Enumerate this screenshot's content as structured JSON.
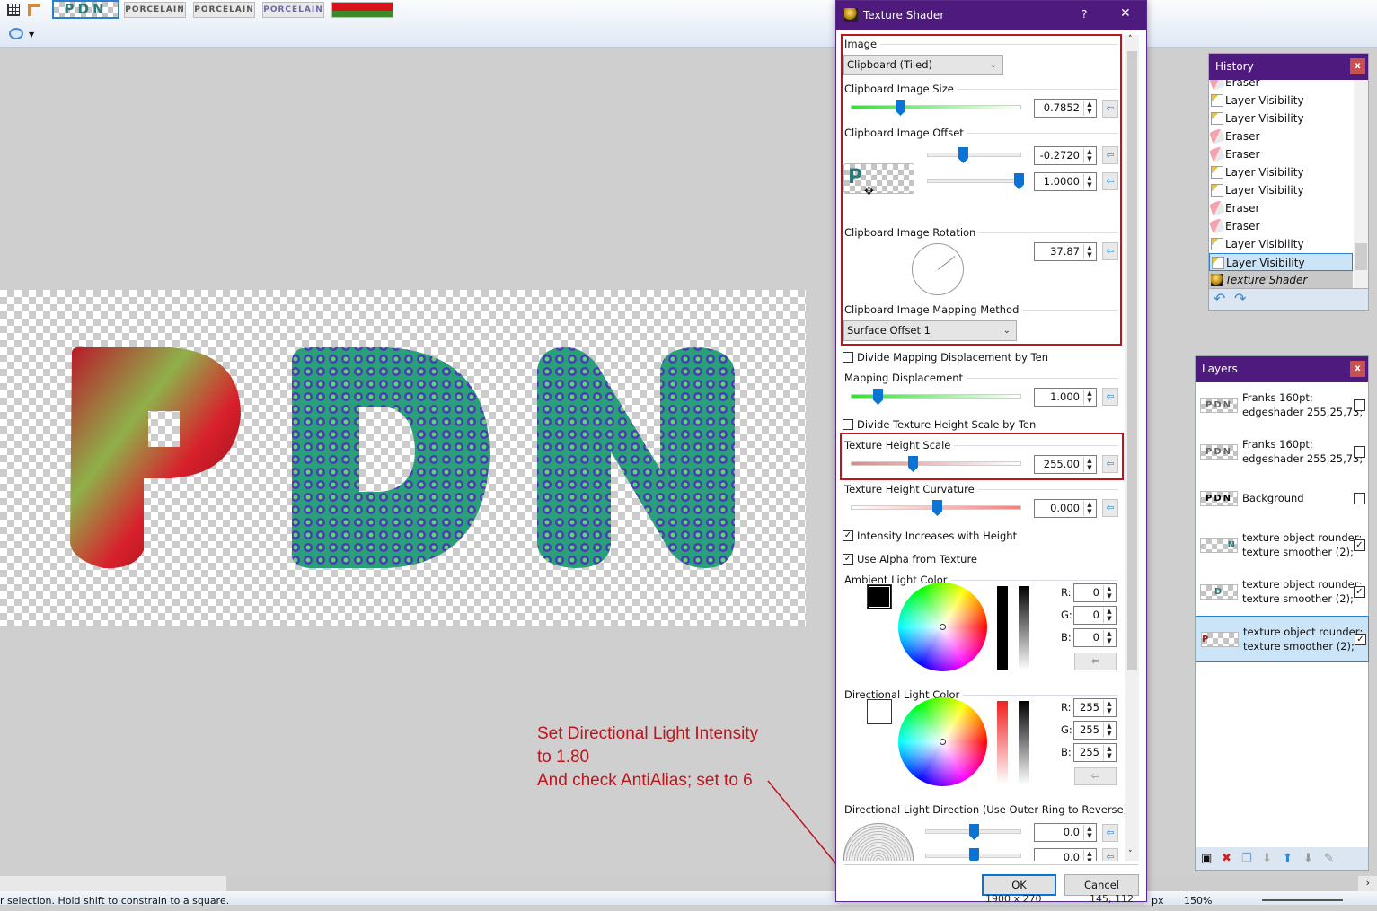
{
  "toolbar": {
    "image_tabs": [
      "PDN",
      "PORCELAIN",
      "PORCELAIN",
      "PORCELAIN"
    ],
    "grid_icon": "grid-icon",
    "ruler_icon": "ruler-icon",
    "selection_icon": "ellipse-select-icon"
  },
  "status": {
    "hint": "r selection. Hold shift to constrain to a square.",
    "size": "1900 x 270",
    "coords": "145, 112",
    "unit": "px",
    "zoom": "150%"
  },
  "annotation": {
    "line1": "Set Directional Light Intensity",
    "line2": "to 1.80",
    "line3": "And check AntiAlias; set to 6",
    "color": "#c0141c"
  },
  "dialog": {
    "title": "Texture Shader",
    "help": "?",
    "close": "✕",
    "image_label": "Image",
    "image_value": "Clipboard (Tiled)",
    "size_label": "Clipboard Image Size",
    "size_value": "0.7852",
    "offset_label": "Clipboard Image Offset",
    "offset_x": "-0.2720",
    "offset_y": "1.0000",
    "rotation_label": "Clipboard Image Rotation",
    "rotation_value": "37.87",
    "mapping_label": "Clipboard Image Mapping Method",
    "mapping_value": "Surface Offset 1",
    "divide_mapping": {
      "label": "Divide Mapping Displacement by Ten",
      "checked": false
    },
    "displacement_label": "Mapping Displacement",
    "displacement_value": "1.000",
    "divide_height": {
      "label": "Divide Texture Height Scale by Ten",
      "checked": false
    },
    "height_scale_label": "Texture Height Scale",
    "height_scale_value": "255.00",
    "curvature_label": "Texture Height Curvature",
    "curvature_value": "0.000",
    "intensity": {
      "label": "Intensity Increases with Height",
      "checked": true
    },
    "alpha": {
      "label": "Use Alpha from Texture",
      "checked": true
    },
    "ambient_label": "Ambient Light Color",
    "ambient": {
      "r": "0",
      "g": "0",
      "b": "0",
      "color": "#000000"
    },
    "directional_label": "Directional Light Color",
    "directional": {
      "r": "255",
      "g": "255",
      "b": "255",
      "color": "#ffffff"
    },
    "direction_label": "Directional Light Direction (Use Outer Ring to Reverse)",
    "direction_1": "0.0",
    "direction_2": "0.0",
    "rgb_labels": [
      "R:",
      "G:",
      "B:"
    ],
    "ok": "OK",
    "cancel": "Cancel",
    "highlight_color": "#c0141c"
  },
  "history": {
    "title": "History",
    "close": "x",
    "items": [
      {
        "label": "Eraser",
        "icon": "eraser-icon"
      },
      {
        "label": "Layer Visibility",
        "icon": "layer-visibility-icon"
      },
      {
        "label": "Layer Visibility",
        "icon": "layer-visibility-icon"
      },
      {
        "label": "Eraser",
        "icon": "eraser-icon"
      },
      {
        "label": "Eraser",
        "icon": "eraser-icon"
      },
      {
        "label": "Layer Visibility",
        "icon": "layer-visibility-icon"
      },
      {
        "label": "Layer Visibility",
        "icon": "layer-visibility-icon"
      },
      {
        "label": "Eraser",
        "icon": "eraser-icon"
      },
      {
        "label": "Eraser",
        "icon": "eraser-icon"
      },
      {
        "label": "Layer Visibility",
        "icon": "layer-visibility-icon"
      },
      {
        "label": "Layer Visibility",
        "icon": "layer-visibility-icon",
        "selected": true
      },
      {
        "label": "Texture Shader",
        "icon": "texture-shader-icon",
        "pending": true
      }
    ]
  },
  "layers": {
    "title": "Layers",
    "close": "x",
    "items": [
      {
        "line1": "Franks 160pt;",
        "line2": "edgeshader 255,25,73;",
        "thumb": "PDN",
        "visible": false
      },
      {
        "line1": "Franks 160pt;",
        "line2": "edgeshader 255,25,73;",
        "thumb": "PDN",
        "visible": false
      },
      {
        "line1": "Background",
        "line2": "",
        "thumb": "PDN",
        "visible": false
      },
      {
        "line1": "texture object rounder;",
        "line2": "texture smoother (2);",
        "thumb": "N",
        "visible": true
      },
      {
        "line1": "texture object rounder;",
        "line2": "texture smoother (2);",
        "thumb": "D",
        "visible": true
      },
      {
        "line1": "texture object rounder;",
        "line2": "texture smoother (2);",
        "thumb": "P",
        "visible": true,
        "selected": true
      }
    ]
  }
}
